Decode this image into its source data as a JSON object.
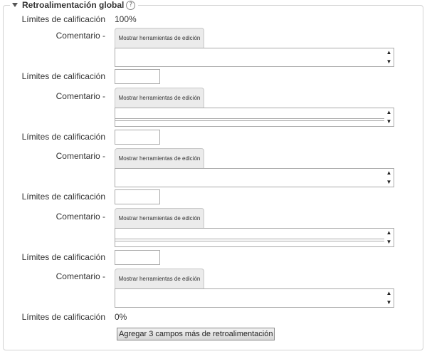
{
  "section": {
    "title": "Retroalimentación global",
    "help_icon": "?"
  },
  "labels": {
    "grade_boundary": "Límites de calificación",
    "comment": "Comentario -"
  },
  "first_boundary_value": "100%",
  "last_boundary_value": "0%",
  "editor_toggle_label": "Mostrar herramientas de edición",
  "boundary_inputs": [
    "",
    "",
    "",
    ""
  ],
  "scroll": {
    "up": "▲",
    "down": "▼"
  },
  "add_button_label": "Agregar 3 campos más de retroalimentación"
}
